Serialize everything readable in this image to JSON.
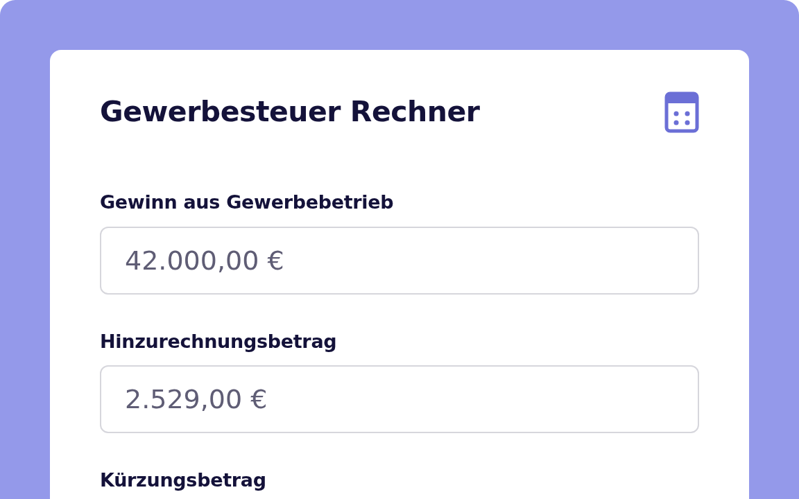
{
  "calculator": {
    "title": "Gewerbesteuer Rechner",
    "fields": [
      {
        "label": "Gewinn aus Gewerbebetrieb",
        "value": "42.000,00 €"
      },
      {
        "label": "Hinzurechnungsbetrag",
        "value": "2.529,00 €"
      },
      {
        "label": "Kürzungsbetrag"
      }
    ]
  }
}
